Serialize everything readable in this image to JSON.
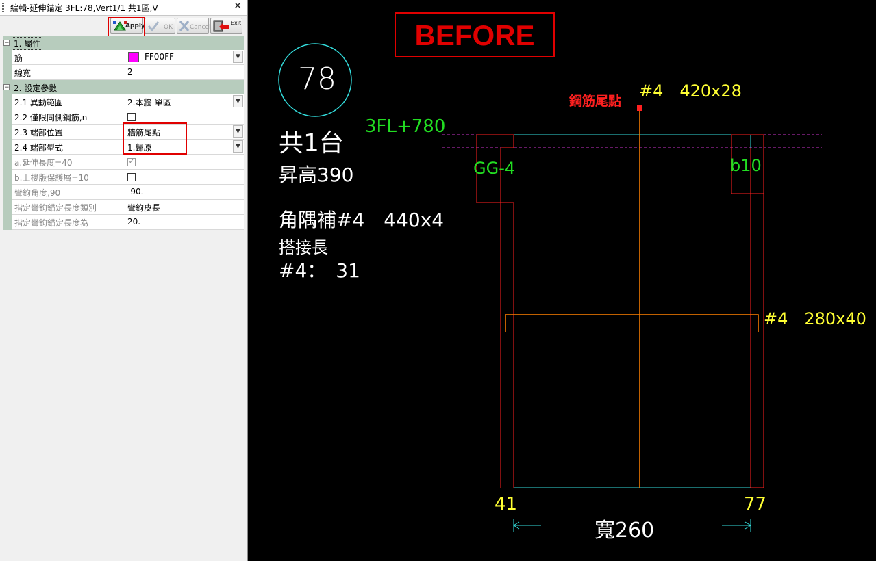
{
  "window": {
    "title": "編輯-延伸錨定 3FL:78,Vert1/1 共1區,V",
    "close_glyph": "✕"
  },
  "toolbar": {
    "apply_label": "Apply",
    "ok_label": "OK",
    "cancel_label": "Cancel",
    "exit_label": "Exit"
  },
  "grid": {
    "cat1": {
      "label": "1. 屬性",
      "toggle": "−"
    },
    "cat2": {
      "label": "2. 設定參數",
      "toggle": "−"
    },
    "rebar_name": "筋",
    "rebar_color_hex": "FF00FF",
    "rebar_color_value": "#ff00ff",
    "linewidth_name": "線寬",
    "linewidth_value": "2",
    "range_name": "2.1 異動範圍",
    "range_value": "2.本牆-單區",
    "sameside_name": "2.2 僅限同側鋼筋,n",
    "endpos_name": "2.3 端部位置",
    "endpos_value": "牆筋尾點",
    "endtype_name": "2.4 端部型式",
    "endtype_value": "1.歸原",
    "extlen_name": "a.延伸長度=40",
    "cover_name": "b.上樓版保護層=10",
    "hookangle_name": "彎鉤角度,90",
    "hookangle_value": "-90.",
    "hooktype_name": "指定彎鉤錨定長度類別",
    "hooktype_value": "彎鉤皮長",
    "hooklen_name": "指定彎鉤錨定長度為",
    "hooklen_value": "20.",
    "check_glyph": "✓",
    "dropdown_glyph": "▼"
  },
  "cad": {
    "before_label": "BEFORE",
    "circle_number": "78",
    "count_text": "共1台",
    "rise_text": "昇高390",
    "corner_rebar_text": "角隅補#4　440x4",
    "lap_label": "搭接長",
    "lap_value": "#4：　31",
    "level_text": "3FL+780",
    "beam_left_text": "GG-4",
    "beam_right_text": "b10",
    "tail_label": "鋼筋尾點",
    "top_rebar_text": "#4　420x28",
    "hoop_rebar_text": "#4　280x40",
    "dim_left": "41",
    "dim_right": "77",
    "width_text": "寬260",
    "colors": {
      "red": "#ff2020",
      "cyan": "#33dddd",
      "yellow": "#ffff33",
      "green": "#22dd22",
      "orange": "#ff8000",
      "magenta": "#cc33cc",
      "white": "#ffffff"
    }
  }
}
